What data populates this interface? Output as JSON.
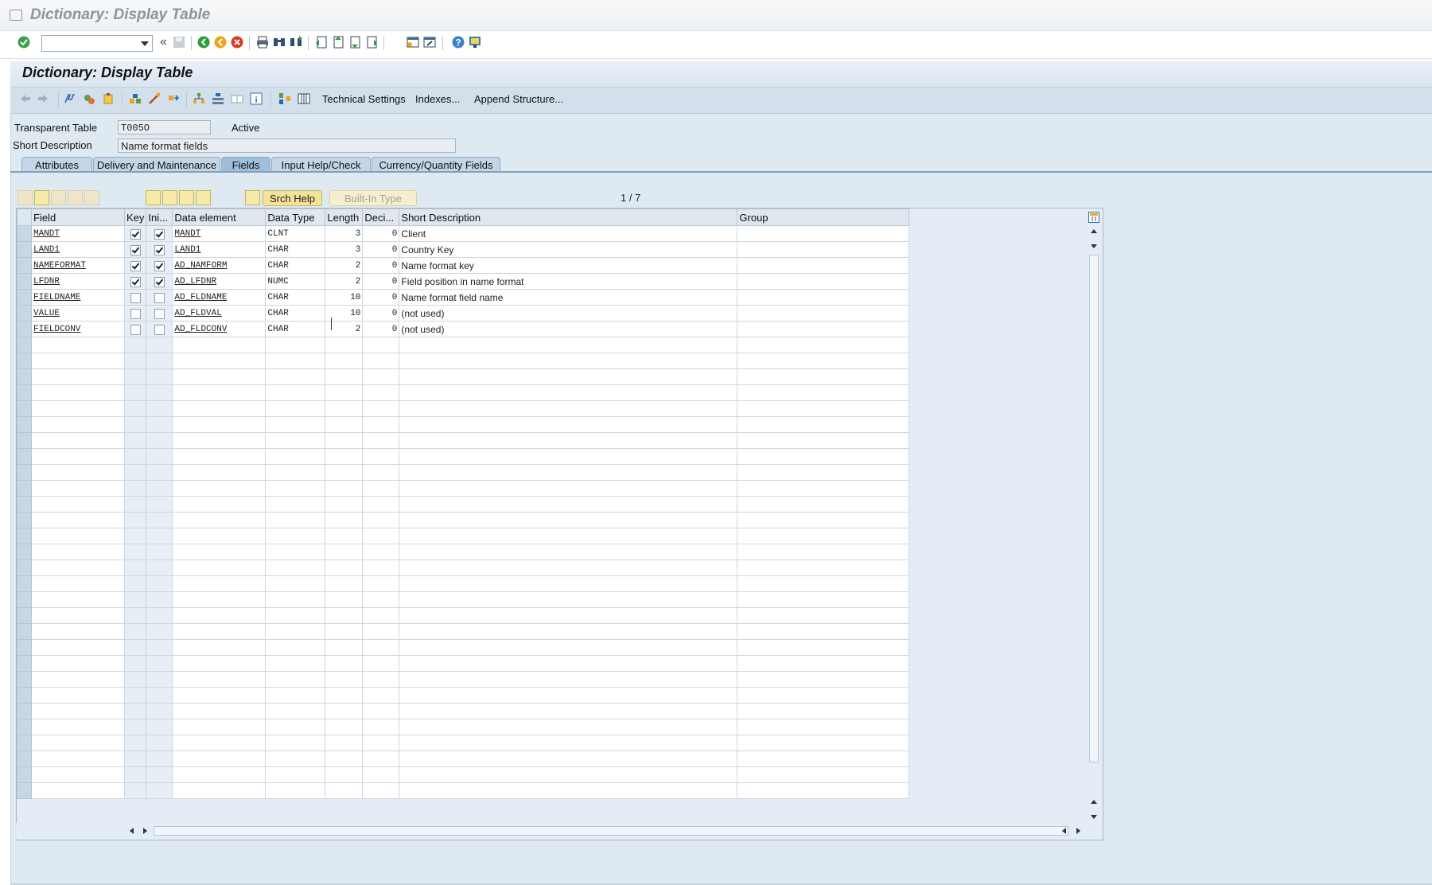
{
  "window": {
    "title": "Dictionary: Display Table"
  },
  "app": {
    "title": "Dictionary: Display Table",
    "toolbar": {
      "technical_settings": "Technical Settings",
      "indexes": "Indexes...",
      "append_structure": "Append Structure..."
    }
  },
  "form": {
    "transparent_table_label": "Transparent Table",
    "transparent_table_value": "T005O",
    "status": "Active",
    "short_description_label": "Short Description",
    "short_description_value": "Name format fields"
  },
  "tabs": [
    {
      "label": "Attributes",
      "active": false
    },
    {
      "label": "Delivery and Maintenance",
      "active": false
    },
    {
      "label": "Fields",
      "active": true
    },
    {
      "label": "Input Help/Check",
      "active": false
    },
    {
      "label": "Currency/Quantity Fields",
      "active": false
    }
  ],
  "grid_toolbar": {
    "srch_help": "Srch Help",
    "built_in_type": "Built-In Type",
    "pager": "1 / 7"
  },
  "grid": {
    "columns": [
      "Field",
      "Key",
      "Ini...",
      "Data element",
      "Data Type",
      "Length",
      "Deci...",
      "Short Description",
      "Group"
    ],
    "rows": [
      {
        "field": "MANDT",
        "key": true,
        "initial": true,
        "data_element": "MANDT",
        "data_type": "CLNT",
        "length": "3",
        "decimals": "0",
        "short_description": "Client",
        "group": ""
      },
      {
        "field": "LAND1",
        "key": true,
        "initial": true,
        "data_element": "LAND1",
        "data_type": "CHAR",
        "length": "3",
        "decimals": "0",
        "short_description": "Country Key",
        "group": ""
      },
      {
        "field": "NAMEFORMAT",
        "key": true,
        "initial": true,
        "data_element": "AD_NAMFORM",
        "data_type": "CHAR",
        "length": "2",
        "decimals": "0",
        "short_description": "Name format key",
        "group": ""
      },
      {
        "field": "LFDNR",
        "key": true,
        "initial": true,
        "data_element": "AD_LFDNR",
        "data_type": "NUMC",
        "length": "2",
        "decimals": "0",
        "short_description": "Field position in name format",
        "group": ""
      },
      {
        "field": "FIELDNAME",
        "key": false,
        "initial": false,
        "data_element": "AD_FLDNAME",
        "data_type": "CHAR",
        "length": "10",
        "decimals": "0",
        "short_description": "Name format field name",
        "group": ""
      },
      {
        "field": "VALUE",
        "key": false,
        "initial": false,
        "data_element": "AD_FLDVAL",
        "data_type": "CHAR",
        "length": "10",
        "decimals": "0",
        "short_description": "(not used)",
        "group": ""
      },
      {
        "field": "FIELDCONV",
        "key": false,
        "initial": false,
        "data_element": "AD_FLDCONV",
        "data_type": "CHAR",
        "length": "2",
        "decimals": "0",
        "short_description": "(not used)",
        "group": ""
      }
    ],
    "empty_rows": 29
  },
  "icons": {
    "system_toolbar": [
      "enter-icon",
      "back-icon",
      "save-icon",
      "back-green-icon",
      "exit-icon",
      "cancel-icon",
      "print-icon",
      "find-icon",
      "find-next-icon",
      "first-page-icon",
      "prev-page-icon",
      "next-page-icon",
      "last-page-icon",
      "new-session-icon",
      "shortcut-icon",
      "help-icon",
      "customize-layout-icon"
    ],
    "app_toolbar": [
      "back-arrow-icon",
      "forward-arrow-icon",
      "display-change-icon",
      "other-object-icon",
      "check-icon",
      "activate-icon",
      "where-used-icon",
      "object-list-icon",
      "navigation-window-icon",
      "hierarchy-icon",
      "info-icon",
      "contents-icon",
      "entity-relationship-icon"
    ]
  }
}
